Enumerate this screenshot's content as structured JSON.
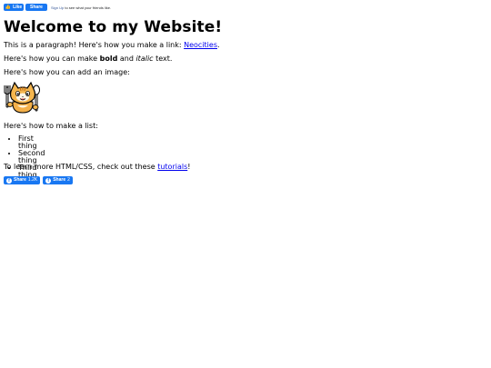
{
  "fb_widget": {
    "like_label": "Like",
    "share_label": "Share",
    "signup_link": "Sign Up",
    "signup_text": " to see what your friends like."
  },
  "page": {
    "title": "Welcome to my Website!",
    "p1_text": "This is a paragraph! Here's how you make a link: ",
    "p1_link": "Neocities",
    "p1_end": ".",
    "p2_start": "Here's how you can make ",
    "p2_bold": "bold",
    "p2_mid": " and ",
    "p2_italic": "italic",
    "p2_end": " text.",
    "p3_text": "Here's how you can add an image:",
    "p4_text": "Here's how to make a list:",
    "list": [
      "First thing",
      "Second thing",
      "Third thing"
    ],
    "p5_text": "To learn more HTML/CSS, check out these ",
    "p5_link": "tutorials",
    "p5_end": "!"
  },
  "share_buttons": [
    {
      "label": "Share",
      "count": "1.2K"
    },
    {
      "label": "Share",
      "count": "2"
    }
  ],
  "colors": {
    "fb_blue": "#1877f2",
    "link": "#0000ee"
  },
  "icons": {
    "mascot": "neocities-cat-mascot",
    "thumbs_up": "thumbs-up-icon",
    "facebook": "facebook-f-icon"
  }
}
